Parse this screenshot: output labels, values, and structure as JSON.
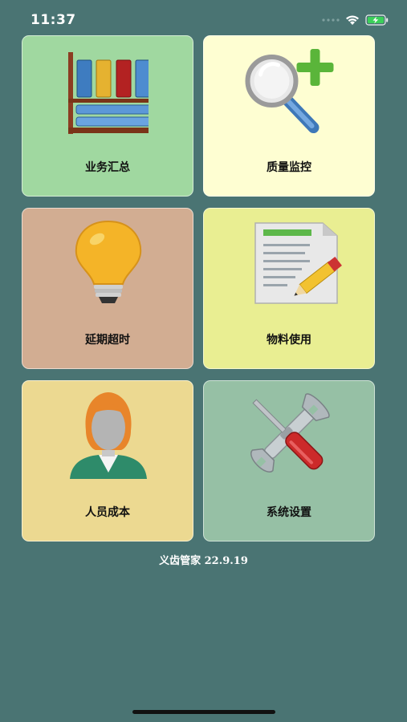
{
  "status_bar": {
    "time": "11:37",
    "icons": [
      "cellular-dots-icon",
      "wifi-icon",
      "battery-charging-icon"
    ]
  },
  "tiles": [
    {
      "label": "业务汇总",
      "icon": "bookshelf-icon",
      "color": "#a0d8a0"
    },
    {
      "label": "质量监控",
      "icon": "magnifier-plus-icon",
      "color": "#fefed2"
    },
    {
      "label": "延期超时",
      "icon": "light-bulb-icon",
      "color": "#d2ad92"
    },
    {
      "label": "物料使用",
      "icon": "document-pencil-icon",
      "color": "#e9ee92"
    },
    {
      "label": "人员成本",
      "icon": "person-icon",
      "color": "#ecd991"
    },
    {
      "label": "系统设置",
      "icon": "tools-icon",
      "color": "#96c0a5"
    }
  ],
  "footer": {
    "app_version": "义齿管家 22.9.19"
  },
  "colors": {
    "background": "#4a7473"
  }
}
